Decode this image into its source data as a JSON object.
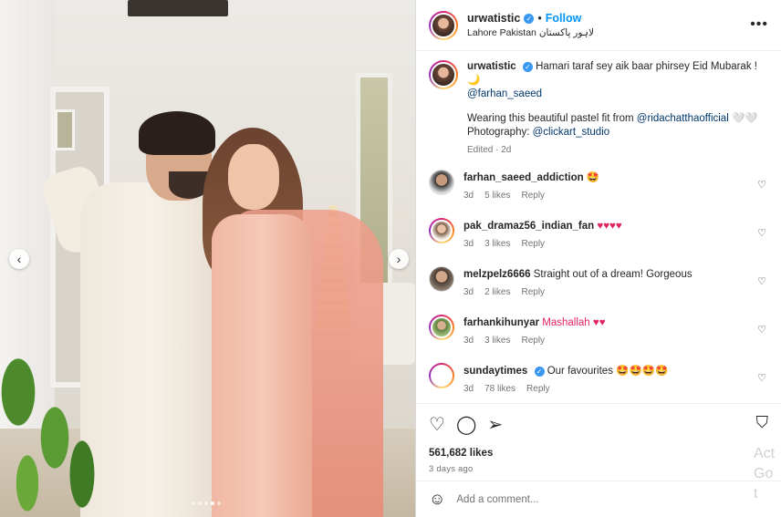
{
  "post": {
    "username": "urwatistic",
    "follow_label": "Follow",
    "bullet": "•",
    "location": "Lahore Pakistan لاہور پاکستان",
    "more_label": "•••",
    "carousel": {
      "prev": "‹",
      "next": "›",
      "dots": 6,
      "active_dot": 4
    }
  },
  "caption": {
    "username": "urwatistic",
    "line1": "Hamari taraf sey aik baar phirsey Eid Mubarak ! 🌙",
    "mention1": "@farhan_saeed",
    "line2_prefix": "Wearing this beautiful pastel fit from ",
    "mention2": "@ridachatthaofficial",
    "line2_suffix": " 🤍🤍",
    "line3_prefix": "Photography: ",
    "mention3": "@clickart_studio",
    "meta": "Edited · 2d"
  },
  "comments": [
    {
      "username": "farhan_saeed_addiction",
      "text": "🤩",
      "time": "3d",
      "likes": "5 likes",
      "reply": "Reply",
      "verified": false
    },
    {
      "username": "pak_dramaz56_indian_fan",
      "text": "♥♥♥♥",
      "time": "3d",
      "likes": "3 likes",
      "reply": "Reply",
      "verified": false
    },
    {
      "username": "melzpelz6666",
      "text": "Straight out of a dream! Gorgeous",
      "time": "3d",
      "likes": "2 likes",
      "reply": "Reply",
      "verified": false
    },
    {
      "username": "farhankihunyar",
      "text": "Mashallah ♥♥",
      "time": "3d",
      "likes": "3 likes",
      "reply": "Reply",
      "verified": false
    },
    {
      "username": "sundaytimes",
      "text": "Our favourites 🤩🤩🤩🤩",
      "time": "3d",
      "likes": "78 likes",
      "reply": "Reply",
      "verified": true
    }
  ],
  "actions": {
    "likes": "561,682 likes",
    "posted_ago": "3 days ago"
  },
  "add_comment": {
    "placeholder": "Add a comment..."
  },
  "watermark": {
    "line1": "Act",
    "line2": "Go t"
  },
  "icons": [
    "heart-icon",
    "comment-icon",
    "share-icon",
    "bookmark-icon",
    "emoji-icon",
    "more-icon",
    "verified-icon"
  ],
  "colors": {
    "link": "#00376b",
    "follow": "#0095f6",
    "verified": "#3897f0",
    "muted": "#737373",
    "text": "#262626"
  }
}
